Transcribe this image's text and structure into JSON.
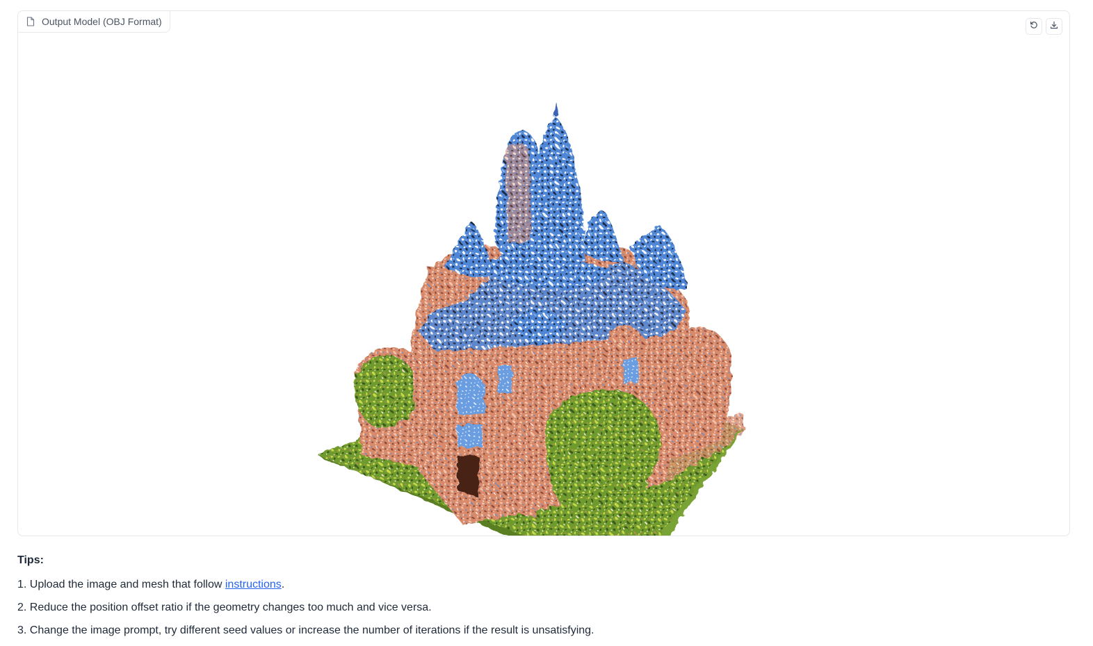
{
  "model_panel": {
    "label": "Output Model (OBJ Format)",
    "icons": {
      "label_icon": "file-icon",
      "reset_button": "rotate-ccw-icon",
      "download_button": "download-icon"
    },
    "model_description": "3D textured castle mesh"
  },
  "tips": {
    "title": "Tips:",
    "items": [
      {
        "number": "1.",
        "before": "Upload the image and mesh that follow ",
        "link": "instructions",
        "after": "."
      },
      {
        "number": "2.",
        "text": "Reduce the position offset ratio if the geometry changes too much and vice versa."
      },
      {
        "number": "3.",
        "text": "Change the image prompt, try different seed values or increase the number of iterations if the result is unsatisfying."
      }
    ]
  },
  "colors": {
    "border": "#e5e7eb",
    "link": "#2563eb",
    "text": "#1f2937",
    "muted": "#4b5563"
  }
}
